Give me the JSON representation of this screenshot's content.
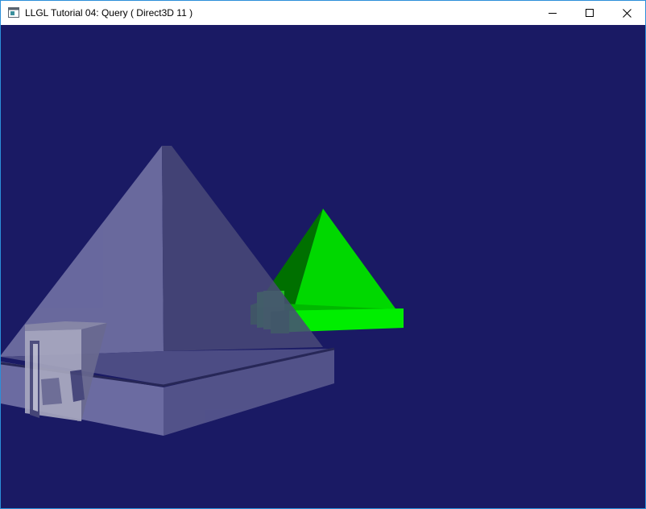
{
  "window": {
    "title": "LLGL Tutorial 04: Query ( Direct3D 11 )",
    "border_color": "#2b8fd9"
  },
  "titlebar": {
    "app_icon": "window-app-icon",
    "buttons": [
      {
        "name": "minimize-button",
        "icon": "minimize-icon"
      },
      {
        "name": "maximize-button",
        "icon": "maximize-icon"
      },
      {
        "name": "close-button",
        "icon": "close-icon"
      }
    ]
  },
  "scene": {
    "background_color": "#1a1a64",
    "objects": [
      {
        "name": "translucent-pyramid-model",
        "color": "#8a8ac4"
      },
      {
        "name": "green-pyramid-model",
        "color": "#00e000"
      }
    ]
  }
}
